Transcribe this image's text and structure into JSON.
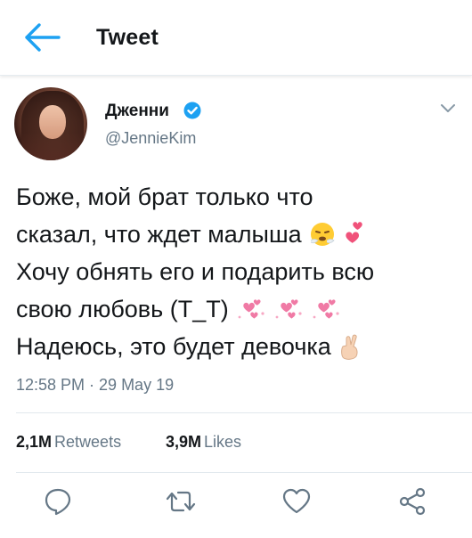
{
  "header": {
    "title": "Tweet",
    "back_icon": "arrow-left-icon",
    "accent_color": "#1da1f2"
  },
  "tweet": {
    "author": {
      "name": "Дженни",
      "handle": "@JennieKim",
      "verified": true
    },
    "text_lines": [
      "Боже, мой брат только что",
      "сказал, что ждет малыша",
      "Хочу обнять его и подарить всю",
      "свою любовь (T_T)",
      "Надеюсь, это будет девочка"
    ],
    "emojis": {
      "line2": [
        "face-with-steam-icon",
        "two-hearts-icon"
      ],
      "line4": [
        "sparkling-hearts-icon",
        "sparkling-hearts-icon",
        "sparkling-hearts-icon"
      ],
      "line5": [
        "crossed-fingers-icon"
      ]
    },
    "timestamp": "12:58 PM · 29 May 19",
    "stats": {
      "retweets_count": "2,1M",
      "retweets_label": "Retweets",
      "likes_count": "3,9M",
      "likes_label": "Likes"
    }
  },
  "actions": [
    "reply-icon",
    "retweet-icon",
    "like-icon",
    "share-icon"
  ]
}
